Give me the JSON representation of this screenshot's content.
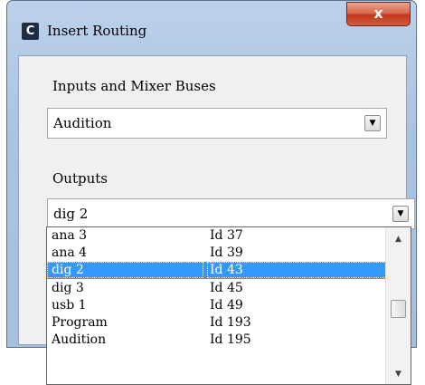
{
  "window": {
    "app_icon_letter": "C",
    "title": "Insert Routing",
    "close_label": "x"
  },
  "inputs": {
    "label": "Inputs and Mixer Buses",
    "value": "Audition",
    "dropdown_glyph": "▼"
  },
  "outputs": {
    "label": "Outputs",
    "value": "dig 2",
    "dropdown_glyph": "▼",
    "list": [
      {
        "name": "ana 3",
        "id": "Id 37"
      },
      {
        "name": "ana 4",
        "id": "Id 39"
      },
      {
        "name": "dig 2",
        "id": "Id 43",
        "selected": true
      },
      {
        "name": "dig 3",
        "id": "Id 45"
      },
      {
        "name": "usb 1",
        "id": "Id 49"
      },
      {
        "name": "Program",
        "id": "Id 193"
      },
      {
        "name": "Audition",
        "id": "Id 195"
      }
    ],
    "scroll_up_glyph": "▲",
    "scroll_down_glyph": "▼"
  },
  "colors": {
    "selection": "#3399ff",
    "close_button": "#c0381d",
    "titlebar": "#aac3e0"
  }
}
